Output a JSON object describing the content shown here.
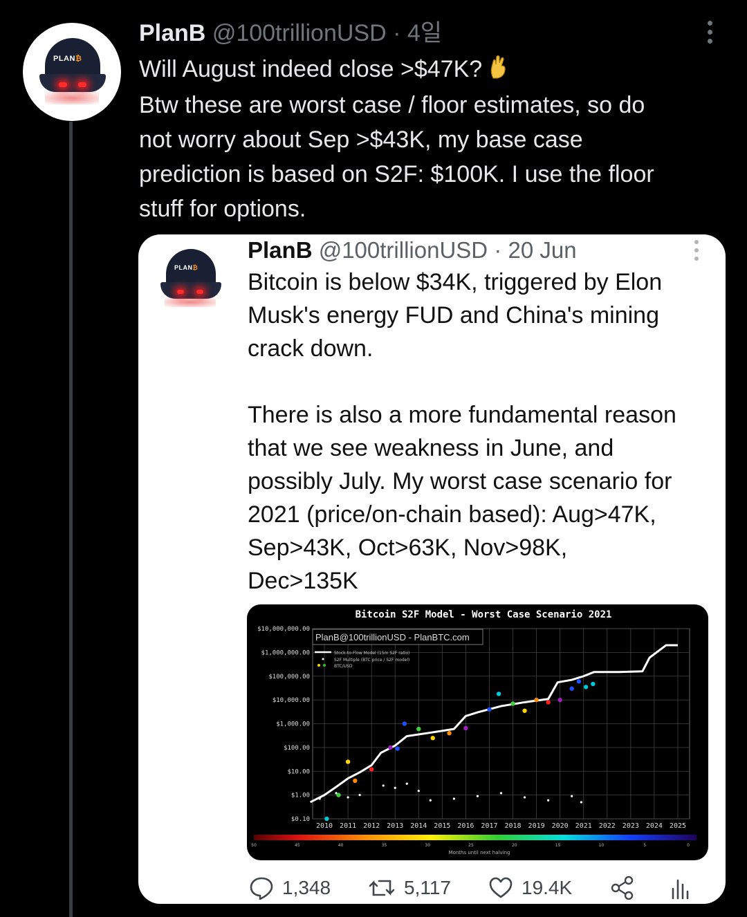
{
  "main_tweet": {
    "author_name": "PlanB",
    "handle": "@100trillionUSD",
    "separator": "·",
    "time": "4일",
    "text_lines": [
      "Will August indeed close >$47K?",
      "Btw these are worst case / floor estimates, so do",
      "not worry about Sep >$43K, my base case",
      "prediction is based on S2F: $100K. I use the floor",
      "stuff for options."
    ],
    "emoji": "crossed-fingers-emoji"
  },
  "quoted_tweet": {
    "author_name": "PlanB",
    "handle": "@100trillionUSD",
    "separator": "·",
    "time": "20 Jun",
    "text_lines": [
      "Bitcoin is below $34K, triggered by Elon",
      "Musk's energy FUD and China's mining",
      "crack down.",
      "",
      "There is also a more fundamental reason",
      "that we see weakness in June, and",
      "possibly July. My worst case scenario for",
      "2021 (price/on-chain based): Aug>47K,",
      "Sep>43K, Oct>63K, Nov>98K,",
      "Dec>135K"
    ]
  },
  "avatar": {
    "cap_text": "PLAN",
    "cap_symbol": "₿"
  },
  "chart": {
    "title": "Bitcoin S2F Model - Worst Case Scenario 2021",
    "watermark": "PlanB@100trillionUSD - PlanBTC.com",
    "legend": [
      "Stock-to-Flow Model (15m S2F ratio)",
      "S2F Multiple (BTC price / S2F model)",
      "BTC/USD"
    ],
    "y_tick_labels": [
      "$10,000,000.00",
      "$1,000,000.00",
      "$100,000.00",
      "$10,000.00",
      "$1,000.00",
      "$100.00",
      "$10.00",
      "$1.00",
      "$0.10"
    ],
    "x_tick_labels": [
      "2010",
      "2011",
      "2012",
      "2013",
      "2014",
      "2015",
      "2016",
      "2017",
      "2018",
      "2019",
      "2020",
      "2021",
      "2022",
      "2023",
      "2024",
      "2025"
    ],
    "colorbar_labels": [
      "50",
      "45",
      "40",
      "35",
      "30",
      "25",
      "20",
      "15",
      "10",
      "5",
      "0"
    ],
    "colorbar_title": "Months until next halving"
  },
  "actions": {
    "replies": "1,348",
    "retweets": "5,117",
    "likes": "19.4K"
  },
  "colors": {
    "background": "#000000",
    "text_primary": "#e7e9ea",
    "text_secondary": "#71767b",
    "card_background": "#ffffff",
    "thread_line": "#3b3d40"
  },
  "chart_data": {
    "type": "line",
    "title": "Bitcoin S2F Model - Worst Case Scenario 2021",
    "xlabel": "",
    "ylabel": "",
    "y_scale": "log",
    "ylim": [
      0.1,
      10000000
    ],
    "xlim": [
      2010,
      2026
    ],
    "grid": true,
    "legend_position": "top-left",
    "series": [
      {
        "name": "Stock-to-Flow Model (15m S2F ratio)",
        "x": [
          2009.9,
          2010.5,
          2011.0,
          2011.5,
          2012.0,
          2012.5,
          2012.9,
          2013.5,
          2014.0,
          2015.0,
          2016.0,
          2016.5,
          2017.0,
          2018.0,
          2019.0,
          2020.0,
          2020.4,
          2021.0,
          2021.5,
          2021.95,
          2023.0,
          2024.0,
          2024.3,
          2025.0,
          2025.5
        ],
        "y": [
          0.5,
          1,
          2.2,
          5,
          9,
          18,
          60,
          120,
          300,
          420,
          600,
          2100,
          3000,
          5500,
          8000,
          11000,
          55000,
          70000,
          100000,
          150000,
          150000,
          160000,
          600000,
          2000000,
          2000000
        ]
      },
      {
        "name": "S2F Multiple (BTC price / S2F model)",
        "x": [
          2010.3,
          2011.0,
          2011.5,
          2012.0,
          2013.0,
          2013.5,
          2014.0,
          2014.5,
          2015.0,
          2016.0,
          2017.0,
          2018.0,
          2019.0,
          2020.0,
          2021.0,
          2021.4
        ],
        "y": [
          0.7,
          1.2,
          0.8,
          1.0,
          2.5,
          2.0,
          3.0,
          1.5,
          0.6,
          0.7,
          0.9,
          1.2,
          0.8,
          0.6,
          0.9,
          0.5
        ]
      },
      {
        "name": "BTC/USD",
        "x": [
          2010.6,
          2011.1,
          2011.5,
          2011.8,
          2012.5,
          2013.3,
          2013.6,
          2013.9,
          2014.5,
          2015.1,
          2015.8,
          2016.5,
          2017.5,
          2017.9,
          2018.5,
          2019.0,
          2019.5,
          2020.0,
          2020.5,
          2021.0,
          2021.3,
          2021.6,
          2021.9
        ],
        "y": [
          0.1,
          1,
          25,
          4,
          12,
          100,
          90,
          1000,
          600,
          250,
          400,
          650,
          4000,
          18000,
          7000,
          3500,
          10000,
          8000,
          10000,
          30000,
          60000,
          35000,
          47000
        ]
      }
    ]
  }
}
